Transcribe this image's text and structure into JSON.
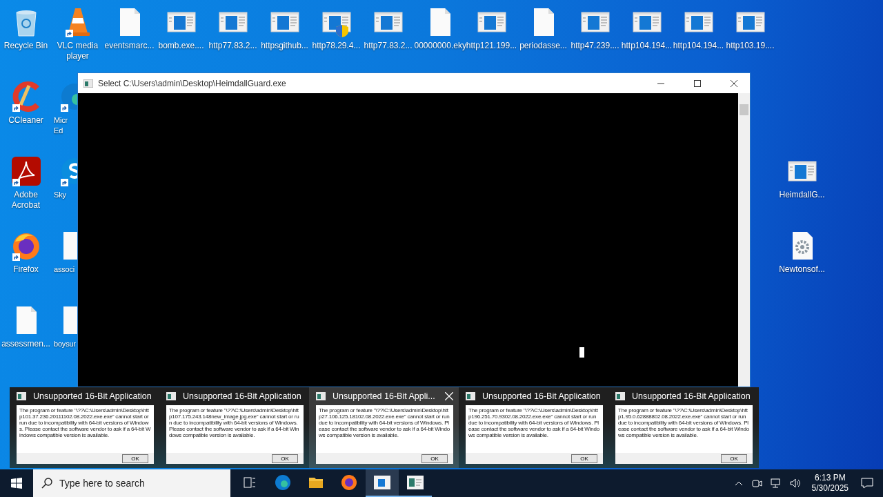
{
  "desktop": {
    "top_row": [
      {
        "label": "Recycle Bin",
        "kind": "recycle",
        "shortcut": false
      },
      {
        "label": "VLC media player",
        "kind": "vlc",
        "shortcut": true
      },
      {
        "label": "eventsmarc...",
        "kind": "file",
        "shortcut": false
      },
      {
        "label": "bomb.exe....",
        "kind": "app",
        "shortcut": false
      },
      {
        "label": "http77.83.2...",
        "kind": "app",
        "shortcut": false
      },
      {
        "label": "httpsgithub...",
        "kind": "app",
        "shortcut": false
      },
      {
        "label": "http78.29.4...",
        "kind": "app-shield",
        "shortcut": false
      },
      {
        "label": "http77.83.2...",
        "kind": "app",
        "shortcut": false
      },
      {
        "label": "00000000.eky",
        "kind": "file",
        "shortcut": false
      },
      {
        "label": "http121.199...",
        "kind": "app",
        "shortcut": false
      },
      {
        "label": "periodasse...",
        "kind": "file",
        "shortcut": false
      },
      {
        "label": "http47.239....",
        "kind": "app",
        "shortcut": false
      },
      {
        "label": "http104.194...",
        "kind": "app",
        "shortcut": false
      },
      {
        "label": "http104.194...",
        "kind": "app",
        "shortcut": false
      },
      {
        "label": "http103.19....",
        "kind": "app",
        "shortcut": false
      }
    ],
    "left_column": [
      {
        "label": "CCleaner",
        "kind": "ccleaner",
        "shortcut": true
      },
      {
        "label": "Adobe Acrobat",
        "kind": "acrobat",
        "shortcut": true
      },
      {
        "label": "Firefox",
        "kind": "firefox",
        "shortcut": true
      },
      {
        "label": "assessmen...",
        "kind": "file",
        "shortcut": false
      }
    ],
    "second_column": [
      {
        "label": "Micr\nEd",
        "kind": "edge",
        "shortcut": true
      },
      {
        "label": "Sky",
        "kind": "skype",
        "shortcut": true
      },
      {
        "label": "associ",
        "kind": "file",
        "shortcut": false
      },
      {
        "label": "boysur",
        "kind": "file",
        "shortcut": false
      }
    ],
    "right_column": [
      {
        "label": "HeimdallG...",
        "kind": "app",
        "shortcut": false
      },
      {
        "label": "Newtonsof...",
        "kind": "gear-file",
        "shortcut": false
      }
    ]
  },
  "console_window": {
    "title": "Select C:\\Users\\admin\\Desktop\\HeimdallGuard.exe"
  },
  "previews": [
    {
      "title": "Unsupported 16-Bit Application",
      "selected": false,
      "message": "The program or feature \"\\??\\C:\\Users\\admin\\Desktop\\http101.37.236.20111102.08.2022.exe.exe\" cannot start or run due to incompatibility with 64-bit versions of Windows. Please contact the software vendor to ask if a 64-bit Windows compatible version is available.",
      "button": "OK"
    },
    {
      "title": "Unsupported 16-Bit Application",
      "selected": false,
      "message": "The program or feature \"\\??\\C:\\Users\\admin\\Desktop\\http107.175.243.148new_image.jpg.exe\" cannot start or run due to incompatibility with 64-bit versions of Windows. Please contact the software vendor to ask if a 64-bit Windows compatible version is available.",
      "button": "OK"
    },
    {
      "title": "Unsupported 16-Bit Appli...",
      "selected": true,
      "message": "The program or feature \"\\??\\C:\\Users\\admin\\Desktop\\http27.106.125.18102.08.2022.exe.exe\" cannot start or run due to incompatibility with 64-bit versions of Windows. Please contact the software vendor to ask if a 64-bit Windows compatible version is available.",
      "button": "OK"
    },
    {
      "title": "Unsupported 16-Bit Application",
      "selected": false,
      "message": "The program or feature \"\\??\\C:\\Users\\admin\\Desktop\\http196.251.70.9302.08.2022.exe.exe\" cannot start or run due to incompatibility with 64-bit versions of Windows. Please contact the software vendor to ask if a 64-bit Windows compatible version is available.",
      "button": "OK"
    },
    {
      "title": "Unsupported 16-Bit Application",
      "selected": false,
      "message": "The program or feature \"\\??\\C:\\Users\\admin\\Desktop\\http1.95.0.62888802.08.2022.exe.exe\" cannot start or run due to incompatibility with 64-bit versions of Windows. Please contact the software vendor to ask if a 64-bit Windows compatible version is available.",
      "button": "OK"
    }
  ],
  "taskbar": {
    "search": {
      "placeholder": "Type here to search"
    },
    "apps": [
      {
        "kind": "task-view",
        "running": false,
        "selected": false
      },
      {
        "kind": "edge",
        "running": false,
        "selected": false
      },
      {
        "kind": "explorer",
        "running": false,
        "selected": false
      },
      {
        "kind": "firefox",
        "running": false,
        "selected": false
      },
      {
        "kind": "console",
        "running": true,
        "selected": true
      },
      {
        "kind": "dialog",
        "running": true,
        "selected": false
      }
    ],
    "time": "6:13 PM",
    "date": "5/30/2025"
  }
}
